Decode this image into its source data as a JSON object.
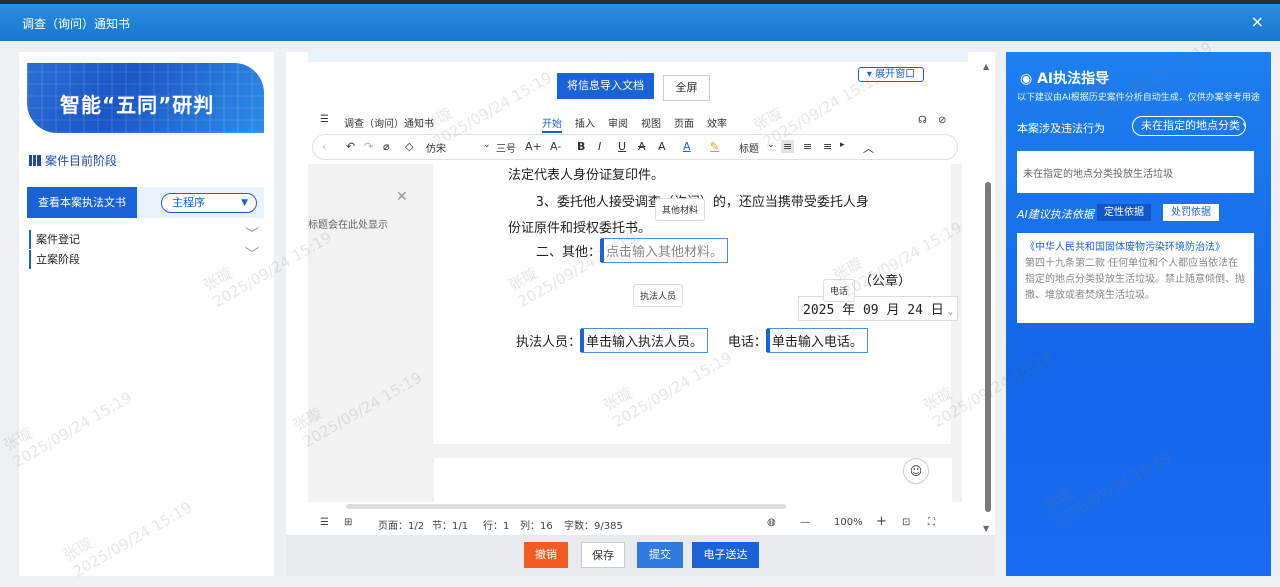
{
  "window": {
    "title": "调查（询问）通知书",
    "close": "×"
  },
  "left": {
    "banner_text": "智能“五同”研判",
    "stage_title": "案件目前阶段",
    "view_doc_button": "查看本案执法文书",
    "program_select": "主程序",
    "tree": [
      "案件登记",
      "立案阶段"
    ]
  },
  "center": {
    "import_button": "将信息导入文档",
    "fullscreen_button": "全屏",
    "expand_button": "展开窗口",
    "doc_name": "调查（询问）通知书",
    "menus": [
      "开始",
      "插入",
      "审阅",
      "视图",
      "页面",
      "效率"
    ],
    "font_name": "仿宋",
    "font_size": "三号",
    "heading_label": "标题",
    "title_placeholder": "标题会在此处显示",
    "doc": {
      "line1": "法定代表人身份证复印件。",
      "line2": "3、委托他人接受调查（询问）的，还应当携带受委托人身",
      "line3": "份证原件和授权委托书。",
      "other_label": "二、其他：",
      "other_field": "点击输入其他材料。",
      "tip_other": "其他材料",
      "seal": "（公章）",
      "date": "2025 年 09 月 24 日",
      "tip_phone": "电话",
      "tip_officer": "执法人员",
      "officer_label": "执法人员：",
      "officer_field": "单击输入执法人员。",
      "phone_label": "电话：",
      "phone_field": "单击输入电话。"
    },
    "status": {
      "page": "页面：1/2",
      "section": "节：1/1",
      "row": "行：1",
      "col": "列：16",
      "words": "字数：9/385",
      "zoom": "100%"
    },
    "footer": {
      "revoke": "撤销",
      "save": "保存",
      "submit": "提交",
      "deliver": "电子送达"
    }
  },
  "right": {
    "title": "AI执法指导",
    "subtitle": "以下建议由AI根据历史案件分析自动生成，仅供办案参考用途",
    "violation_label": "本案涉及违法行为",
    "violation_select": "未在指定的地点分类",
    "violation_text": "未在指定的地点分类投放生活垃圾",
    "basis_label": "AI建议执法依据",
    "basis_btn1": "定性依据",
    "basis_btn2": "处罚依据",
    "law_title": "《中华人民共和国固体废物污染环境防治法》",
    "law_content": "第四十九条第二款 任何单位和个人都应当依法在指定的地点分类投放生活垃圾。禁止随意倾倒、抛撒、堆放或者焚烧生活垃圾。"
  },
  "watermark": {
    "name": "张璇",
    "time": "2025/09/24 15:19"
  },
  "colors": {
    "primary": "#1a63d6",
    "revoke": "#f15a22"
  }
}
